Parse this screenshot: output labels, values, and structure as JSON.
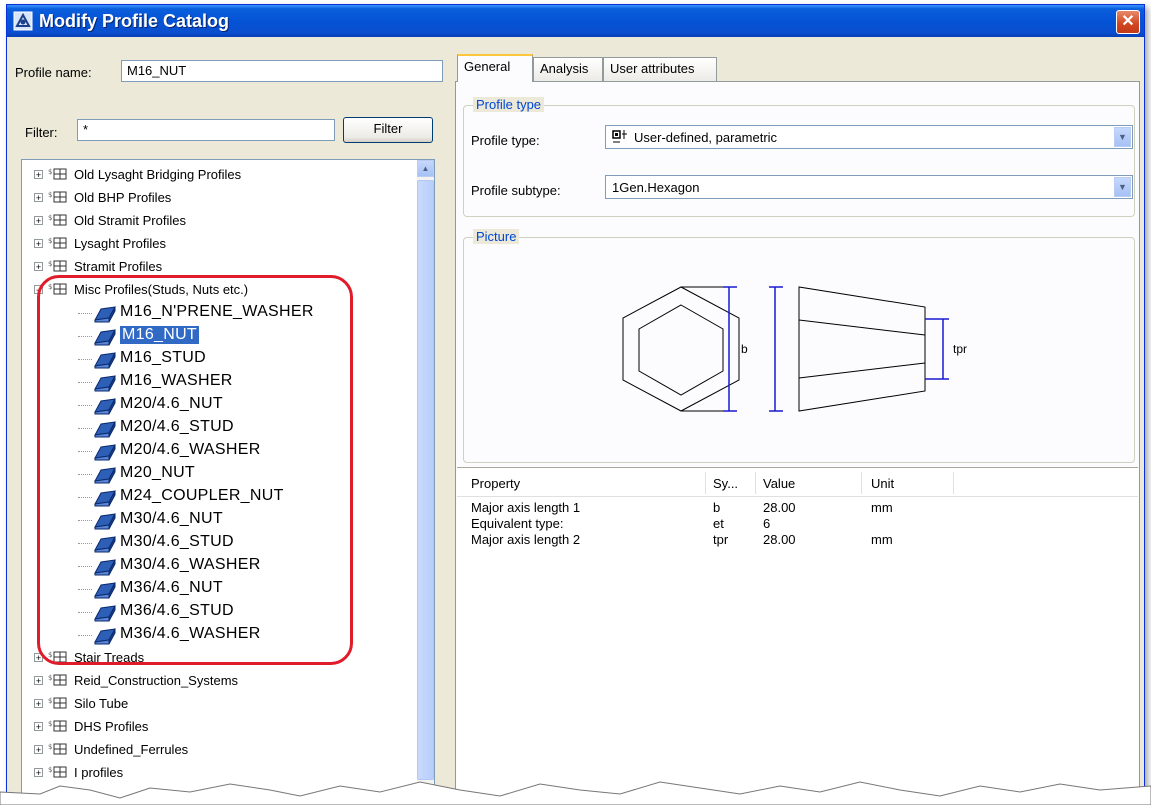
{
  "window": {
    "title": "Modify Profile Catalog"
  },
  "profile_name": {
    "label": "Profile name:",
    "value": "M16_NUT"
  },
  "filter": {
    "label": "Filter:",
    "value": "*",
    "button": "Filter"
  },
  "tree": {
    "groups_top": [
      "Old Lysaght Bridging Profiles",
      "Old BHP Profiles",
      "Old Stramit Profiles",
      "Lysaght Profiles",
      "Stramit Profiles",
      "Misc Profiles(Studs, Nuts etc.)"
    ],
    "misc_items": [
      "M16_N'PRENE_WASHER",
      "M16_NUT",
      "M16_STUD",
      "M16_WASHER",
      "M20/4.6_NUT",
      "M20/4.6_STUD",
      "M20/4.6_WASHER",
      "M20_NUT",
      "M24_COUPLER_NUT",
      "M30/4.6_NUT",
      "M30/4.6_STUD",
      "M30/4.6_WASHER",
      "M36/4.6_NUT",
      "M36/4.6_STUD",
      "M36/4.6_WASHER"
    ],
    "selected_item": "M16_NUT",
    "groups_bottom": [
      "Stair Treads",
      "Reid_Construction_Systems",
      "Silo Tube",
      "DHS Profiles",
      "Undefined_Ferrules",
      "I profiles"
    ]
  },
  "tabs": [
    "General",
    "Analysis",
    "User attributes"
  ],
  "active_tab": "General",
  "profile_type_group": {
    "title": "Profile type",
    "type_label": "Profile type:",
    "type_value": "User-defined, parametric",
    "subtype_label": "Profile subtype:",
    "subtype_value": "1Gen.Hexagon"
  },
  "picture_group": {
    "title": "Picture",
    "label_b": "b",
    "label_tpr": "tpr"
  },
  "properties": {
    "headers": {
      "property": "Property",
      "symbol": "Sy...",
      "value": "Value",
      "unit": "Unit"
    },
    "rows": [
      {
        "property": "Major axis length 1",
        "symbol": "b",
        "value": "28.00",
        "unit": "mm"
      },
      {
        "property": "Equivalent type:",
        "symbol": "et",
        "value": "6",
        "unit": ""
      },
      {
        "property": "Major axis length 2",
        "symbol": "tpr",
        "value": "28.00",
        "unit": "mm"
      }
    ]
  },
  "colors": {
    "titlebar": "#0553d6",
    "selection": "#316ac5",
    "highlight_box": "#e01b2a",
    "group_title": "#0046d5"
  }
}
